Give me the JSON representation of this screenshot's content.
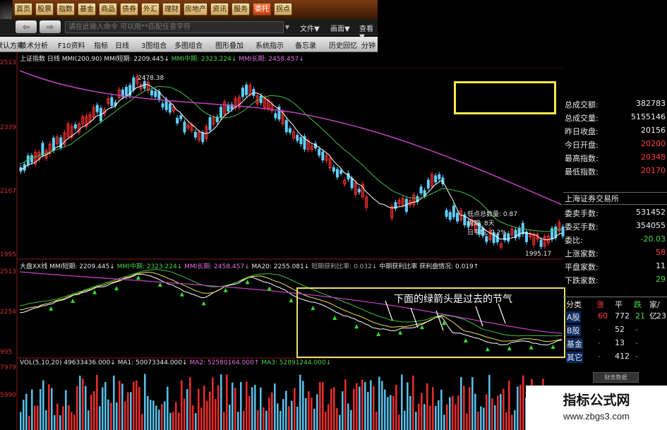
{
  "nav": {
    "items": [
      "首页",
      "股票",
      "指数",
      "基金",
      "商品",
      "债券",
      "外汇",
      "理财",
      "房地产",
      "资讯",
      "服务",
      "委托",
      "拐点"
    ],
    "active_index": 11
  },
  "cmdbar": {
    "input_placeholder": "请在此输入命令  可以用**匹配任意字符",
    "menu_file": "文件▼",
    "menu_view": "画面▼",
    "menu_look": "查看▼"
  },
  "toolbar": {
    "items": [
      "默认方案",
      "技术分析",
      "F10资料",
      "指标",
      "日线",
      "3图组合",
      "多图组合",
      "图形叠加",
      "系统指示",
      "备忘录",
      "历史回忆",
      "分钟"
    ]
  },
  "chart": {
    "title_name": "上证指数 日线",
    "title_mmi": "MMI(200,90)",
    "title_short": "MMI短期: 2209.445↓",
    "title_mid": "MMI中期: 2323.224↓",
    "title_long": "MMI长期: 2458.457↓",
    "y_top": "2513",
    "y_2339": "2339",
    "y_2167": "2167",
    "y_1995": "1995",
    "high_label": "2478.38",
    "low_label": "1995.17",
    "ann_line1": "低点总数量: 0.87",
    "ann_line2": "周期: 8天",
    "ann_line3": "日平均: 0.2%"
  },
  "sub": {
    "title_a": "大盘XX线",
    "title_short": "MMI短期: 2209.445↓",
    "title_mid": "MMI中期: 2323.224↓",
    "title_long": "MMI长期: 2458.457↓",
    "title_ma20": "MA20: 2255.081↓",
    "title_ratio": "短期获利比率: 0.032↓",
    "title_ratio2": "中期获利比率 获利盘情况: 0.019↑",
    "y_top": "2513",
    "y_mid": "2254",
    "y_bot": "995",
    "note": "下面的绿箭头是过去的节气"
  },
  "vol": {
    "title_main": "VOL(5,10,20)",
    "title_val": "49633436.000↓",
    "title_ma1": "MA1: 50073344.000↓",
    "title_ma2": "MA2: 52580164.000↑",
    "title_ma3": "MA3: 52891244.000↓",
    "y_top": "7979",
    "y_mid": "5990",
    "y_bot": "5990"
  },
  "panel": {
    "rows": [
      {
        "label": "总成交额:",
        "value": "382783",
        "color": "#f0f0f0"
      },
      {
        "label": "总成交量:",
        "value": "5155146",
        "color": "#f0f0f0"
      },
      {
        "label": "昨日收盘:",
        "value": "20156",
        "color": "#f0f0f0"
      },
      {
        "label": "今日开盘:",
        "value": "20200",
        "color": "#ff4040"
      },
      {
        "label": "最高指数:",
        "value": "20348",
        "color": "#ff4040"
      },
      {
        "label": "最低指数:",
        "value": "20170",
        "color": "#ff4040"
      }
    ],
    "exchange": "上海证券交易所",
    "rows2": [
      {
        "label": "委卖手数:",
        "value": "531452",
        "color": "#f0f0f0"
      },
      {
        "label": "委买手数:",
        "value": "354055",
        "color": "#f0f0f0"
      },
      {
        "label": "委比:",
        "value": "-20.03",
        "color": "#40e040"
      },
      {
        "label": "上涨家数:",
        "value": "58",
        "color": "#ff4040"
      },
      {
        "label": "平盘家数:",
        "value": "11",
        "color": "#f0f0f0"
      },
      {
        "label": "下跌家数:",
        "value": "29",
        "color": "#40e040"
      }
    ],
    "stats_header": [
      "分类",
      "涨",
      "平",
      "跌",
      "家/亿"
    ],
    "stats_rows": [
      {
        "cat": "A股",
        "up": "60",
        "flat": "772",
        "down": "21",
        "amt": "23"
      },
      {
        "cat": "B股",
        "up": "-",
        "flat": "52",
        "down": "-",
        "amt": ""
      },
      {
        "cat": "基金",
        "up": "-",
        "flat": "13",
        "down": "-",
        "amt": ""
      },
      {
        "cat": "其它",
        "up": "-",
        "flat": "412",
        "down": "-",
        "amt": ""
      }
    ],
    "fin_button": "财务数据"
  },
  "watermark": {
    "line1": "指标公式网",
    "line2": "www.zbgs3.com"
  }
}
